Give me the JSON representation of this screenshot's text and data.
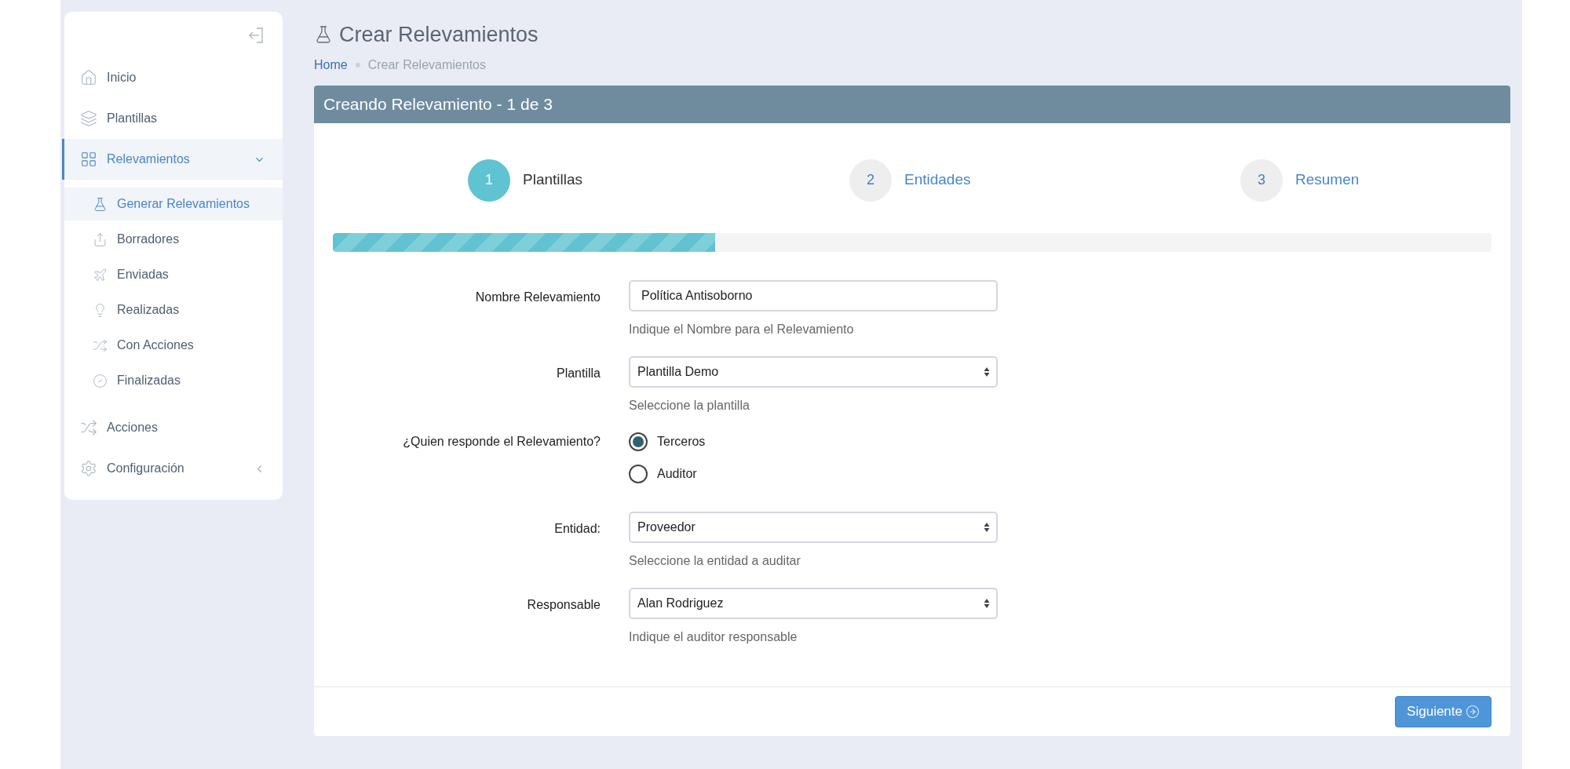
{
  "sidebar": {
    "items": [
      {
        "label": "Inicio",
        "selected": false
      },
      {
        "label": "Plantillas",
        "selected": false
      },
      {
        "label": "Relevamientos",
        "selected": true,
        "expanded": true,
        "children": [
          {
            "label": "Generar Relevamientos",
            "selected": true
          },
          {
            "label": "Borradores",
            "selected": false
          },
          {
            "label": "Enviadas",
            "selected": false
          },
          {
            "label": "Realizadas",
            "selected": false
          },
          {
            "label": "Con Acciones",
            "selected": false
          },
          {
            "label": "Finalizadas",
            "selected": false
          }
        ]
      },
      {
        "label": "Acciones",
        "selected": false
      },
      {
        "label": "Configuración",
        "selected": false,
        "expanded": false
      }
    ]
  },
  "page": {
    "title": "Crear Relevamientos",
    "breadcrumb": [
      "Home",
      "Crear Relevamientos"
    ]
  },
  "panel": {
    "title": "Creando Relevamiento - 1 de 3",
    "steps": [
      {
        "number": "1",
        "label": "Plantillas",
        "selected": true
      },
      {
        "number": "2",
        "label": "Entidades",
        "selected": false
      },
      {
        "number": "3",
        "label": "Resumen",
        "selected": false
      }
    ],
    "progress": {
      "level": 0.33
    },
    "fields": [
      {
        "kind": "text",
        "label": "Nombre Relevamiento",
        "value": "Política Antisoborno",
        "help": "Indique el Nombre para el Relevamiento"
      },
      {
        "kind": "select",
        "label": "Plantilla",
        "value": "Plantilla Demo",
        "help": "Seleccione la plantilla"
      },
      {
        "kind": "radio",
        "label": "¿Quien responde el Relevamiento?",
        "options": [
          {
            "label": "Terceros",
            "selected": true
          },
          {
            "label": "Auditor",
            "selected": false
          }
        ]
      },
      {
        "kind": "select",
        "label": "Entidad:",
        "value": "Proveedor",
        "help": "Seleccione la entidad a auditar"
      },
      {
        "kind": "select",
        "label": "Responsable",
        "value": "Alan Rodriguez",
        "help": "Indique el auditor responsable"
      }
    ],
    "next_button": "Siguiente"
  }
}
